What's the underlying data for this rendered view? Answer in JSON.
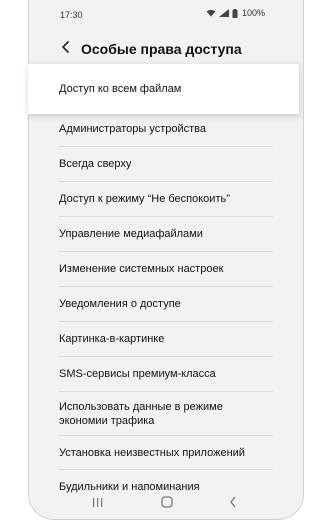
{
  "status_bar": {
    "time": "17:30",
    "battery": "100%"
  },
  "header": {
    "title": "Особые права доступа"
  },
  "highlighted_item": "Доступ ко всем файлам",
  "items": [
    "Администраторы устройства",
    "Всегда сверху",
    "Доступ к режиму “Не беспокоить”",
    "Управление медиафайлами",
    "Изменение системных настроек",
    "Уведомления о доступе",
    "Картинка-в-картинке",
    "SMS-сервисы премиум-класса",
    "Использовать данные в режиме экономии трафика",
    "Установка неизвестных приложений",
    "Будильники и напоминания"
  ]
}
